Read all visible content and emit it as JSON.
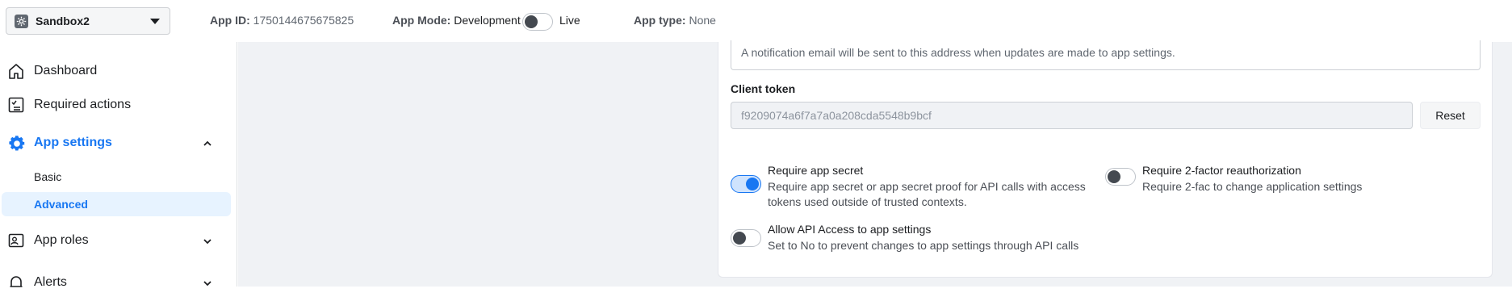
{
  "topbar": {
    "app_name": "Sandbox2",
    "app_id_label": "App ID:",
    "app_id_value": "1750144675675825",
    "app_mode_label": "App Mode:",
    "app_mode_value": "Development",
    "live_label": "Live",
    "app_type_label": "App type:",
    "app_type_value": "None"
  },
  "sidebar": {
    "items": [
      {
        "label": "Dashboard",
        "icon": "home-icon"
      },
      {
        "label": "Required actions",
        "icon": "checklist-icon"
      },
      {
        "label": "App settings",
        "icon": "gear-icon",
        "expanded": true
      },
      {
        "label": "App roles",
        "icon": "roles-icon",
        "expanded": false
      },
      {
        "label": "Alerts",
        "icon": "bell-icon",
        "expanded": false
      }
    ],
    "sub_items": [
      {
        "label": "Basic"
      },
      {
        "label": "Advanced",
        "selected": true
      }
    ]
  },
  "main": {
    "email_hint": "A notification email will be sent to this address when updates are made to app settings.",
    "client_token_label": "Client token",
    "client_token_value": "f9209074a6f7a7a0a208cda5548b9bcf",
    "reset_label": "Reset",
    "settings": [
      {
        "title": "Require app secret",
        "desc": "Require app secret or app secret proof for API calls with access tokens used outside of trusted contexts.",
        "on": true
      },
      {
        "title": "Require 2-factor reauthorization",
        "desc": "Require 2-fac to change application settings",
        "on": false
      },
      {
        "title": "Allow API Access to app settings",
        "desc": "Set to No to prevent changes to app settings through API calls",
        "on": false
      }
    ]
  },
  "colors": {
    "accent": "#1877f2",
    "background": "#f0f2f5",
    "selected_bg": "#e7f3ff"
  }
}
